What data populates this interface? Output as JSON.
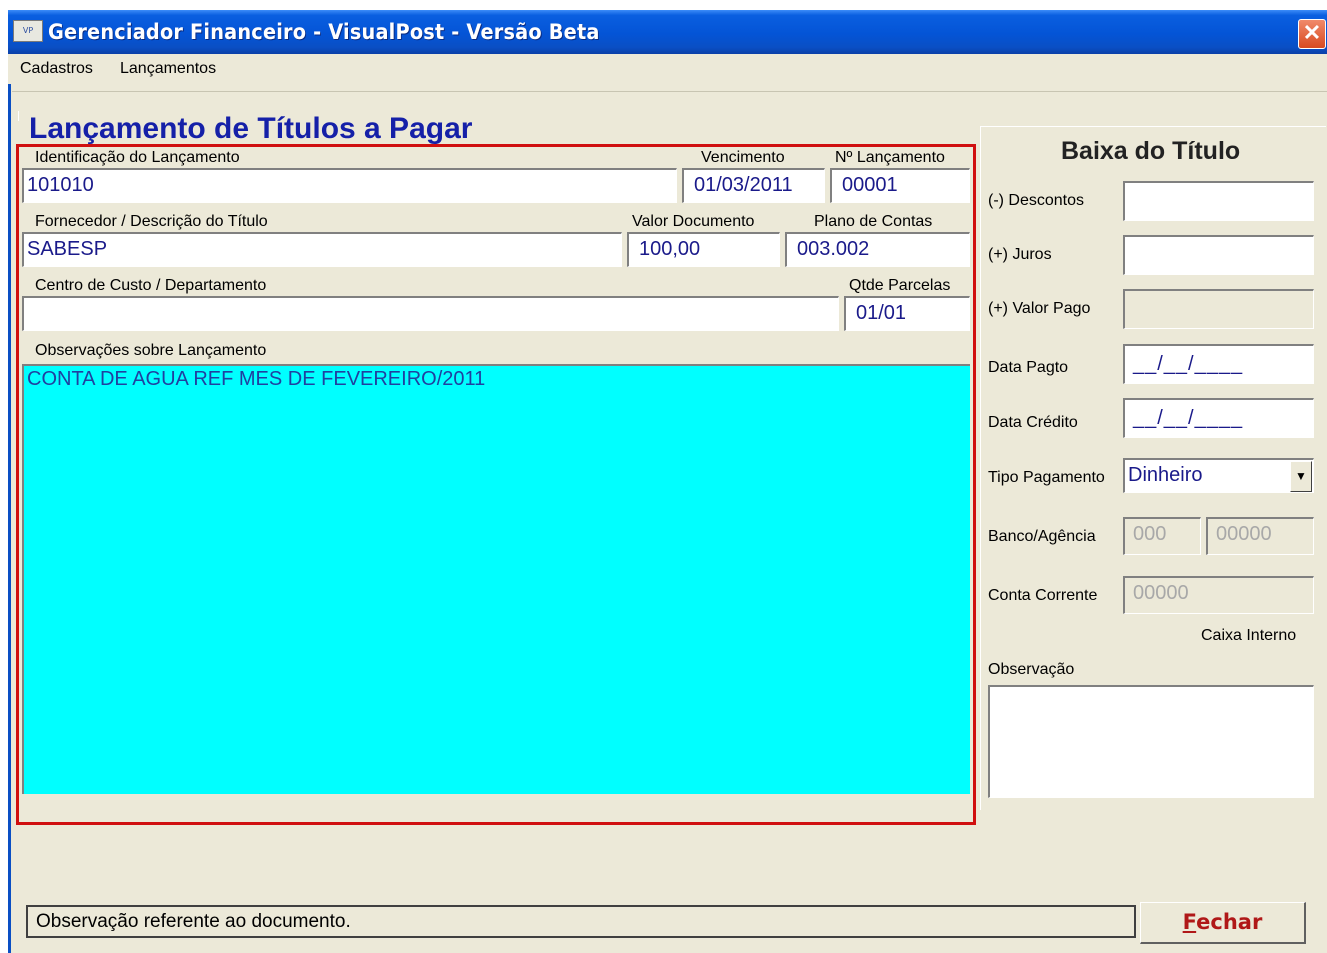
{
  "window": {
    "title": "Gerenciador Financeiro - VisualPost - Versão Beta",
    "icon_label": "VP",
    "close_glyph": "✕"
  },
  "menu": {
    "items": [
      "Cadastros",
      "Lançamentos"
    ]
  },
  "form": {
    "title": "Lançamento de Títulos a Pagar",
    "identificacao": {
      "label": "Identificação do Lançamento",
      "value": "101010"
    },
    "vencimento": {
      "label": "Vencimento",
      "value": "01/03/2011"
    },
    "numero": {
      "label": "Nº Lançamento",
      "value": "00001"
    },
    "fornecedor": {
      "label": "Fornecedor / Descrição do Título",
      "value": "SABESP"
    },
    "valor": {
      "label": "Valor Documento",
      "value": "100,00"
    },
    "plano": {
      "label": "Plano de Contas",
      "value": "003.002"
    },
    "centro": {
      "label": "Centro de Custo / Departamento",
      "value": ""
    },
    "parcelas": {
      "label": "Qtde Parcelas",
      "value": "01/01"
    },
    "observacoes": {
      "label": "Observações sobre Lançamento",
      "value": "CONTA DE AGUA REF MES DE FEVEREIRO/2011"
    }
  },
  "baixa": {
    "title": "Baixa do Título",
    "descontos": {
      "label": "(-) Descontos",
      "value": ""
    },
    "juros": {
      "label": "(+) Juros",
      "value": ""
    },
    "valor_pago": {
      "label": "(+) Valor Pago",
      "value": ""
    },
    "data_pagto": {
      "label": "Data Pagto",
      "value": "__/__/____"
    },
    "data_credito": {
      "label": "Data Crédito",
      "value": "__/__/____"
    },
    "tipo_pagamento": {
      "label": "Tipo Pagamento",
      "value": "Dinheiro",
      "arrow": "▼"
    },
    "banco_agencia": {
      "label": "Banco/Agência",
      "banco": "000",
      "agencia": "00000"
    },
    "conta_corrente": {
      "label": "Conta Corrente",
      "value": "00000"
    },
    "caixa_interno": "Caixa Interno",
    "observacao": {
      "label": "Observação",
      "value": ""
    }
  },
  "statusbar": {
    "text": "Observação referente ao documento."
  },
  "buttons": {
    "fechar_first": "F",
    "fechar_rest": "echar"
  },
  "colors": {
    "title_blue": "#1520a8",
    "memo_cyan": "#00ffff",
    "frame_red": "#d01010",
    "titlebar": "#0454d6"
  }
}
